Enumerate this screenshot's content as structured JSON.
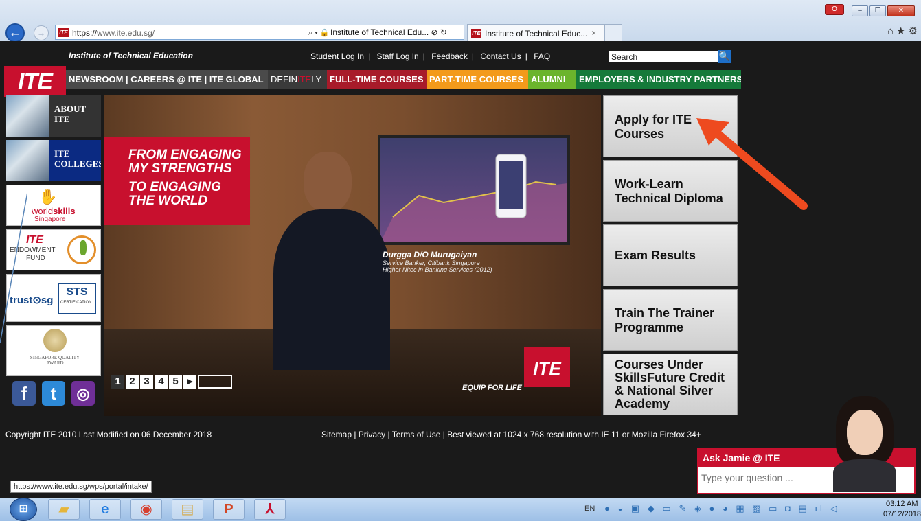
{
  "browser": {
    "url_prefix": "https://",
    "url_host": "www.ite.edu.sg/",
    "tab1_title": "Institute of Technical Edu...",
    "tab2_title": "Institute of Technical Educ...",
    "tab_close": "×",
    "red_button": "O",
    "min": "–",
    "max": "❐",
    "close": "✕",
    "nav_back": "←",
    "nav_fwd": "→",
    "addr_tools": "⌕ ▾ 🔒",
    "tab1_tools": "⊘ ↻",
    "right_tools": "⌂★⚙"
  },
  "header": {
    "logo": "ITE",
    "institute_name": "Institute of Technical Education",
    "top_links": [
      "Student Log In",
      "Staff Log In",
      "Feedback",
      "Contact Us",
      "FAQ"
    ],
    "separator": "|",
    "search_value": "Search",
    "search_icon": "🔍"
  },
  "menu": {
    "newsroom": "NEWSROOM |  CAREERS @ ITE  |  ITE GLOBAL",
    "definitely_a": "DEFIN",
    "definitely_b": "ITE",
    "definitely_c": "LY",
    "fulltime": "FULL-TIME COURSES",
    "parttime": "PART-TIME COURSES",
    "alumni": "ALUMNI",
    "employers": "EMPLOYERS & INDUSTRY PARTNERS"
  },
  "sidebar": {
    "about": "ABOUT ITE",
    "colleges": "ITE COLLEGES",
    "worldskills_a": "world",
    "worldskills_b": "skills",
    "worldskills_sub": "Singapore",
    "endowment_logo": "ITE",
    "endowment_1": "ENDOWMENT",
    "endowment_2": "FUND",
    "trust": "trust⊙sg",
    "sts": "STS",
    "sts_sub": "CERTIFICATION",
    "sqa": "SINGAPORE QUALITY AWARD"
  },
  "social": {
    "facebook": "f",
    "twitter": "t",
    "instagram": "◎"
  },
  "hero": {
    "tag1": "FROM ENGAGING MY STRENGTHS",
    "tag2": "TO ENGAGING THE WORLD",
    "name": "Durgga D/O Murugaiyan",
    "role1": "Service Banker, Citibank Singapore",
    "role2": "Higher Nitec in Banking Services (2012)",
    "equip": "EQUIP FOR LIFE",
    "logo": "ITE",
    "pages": [
      "1",
      "2",
      "3",
      "4",
      "5"
    ],
    "next": "▸",
    "current_page": "1"
  },
  "quick_links": {
    "apply": "Apply for ITE Courses",
    "worklearn": "Work-Learn Technical Diploma",
    "exam": "Exam Results",
    "ttt": "Train The Trainer Programme",
    "skillsfuture": "Courses Under SkillsFuture Credit & National Silver Academy"
  },
  "footer": {
    "copyright": "Copyright ITE 2010    Last Modified on 06 December 2018",
    "links": "Sitemap | Privacy | Terms of Use | Best viewed at 1024 x 768 resolution with IE 11 or Mozilla Firefox 34+"
  },
  "chat": {
    "title": "Ask Jamie @ ITE",
    "placeholder": "Type your question ..."
  },
  "status_url": "https://www.ite.edu.sg/wps/portal/intake/",
  "taskbar": {
    "start": "⊞",
    "folder": "▰",
    "ie": "e",
    "chrome": "◉",
    "files": "▤",
    "ppt": "P",
    "pdf": "⅄",
    "lang": "EN",
    "tray": "● ◒ ▣ ◆ ▭ ✎ ◈ ● ◕ ▦ ▧ ▭ ◘ ▤ ıl ◁",
    "time": "03:12 AM",
    "date": "07/12/2018"
  },
  "colors": {
    "ite_red": "#c8102e",
    "parttime": "#f39a1b",
    "alumni": "#6bb42c",
    "employers": "#157a3a",
    "arrow": "#ee4a1f"
  }
}
